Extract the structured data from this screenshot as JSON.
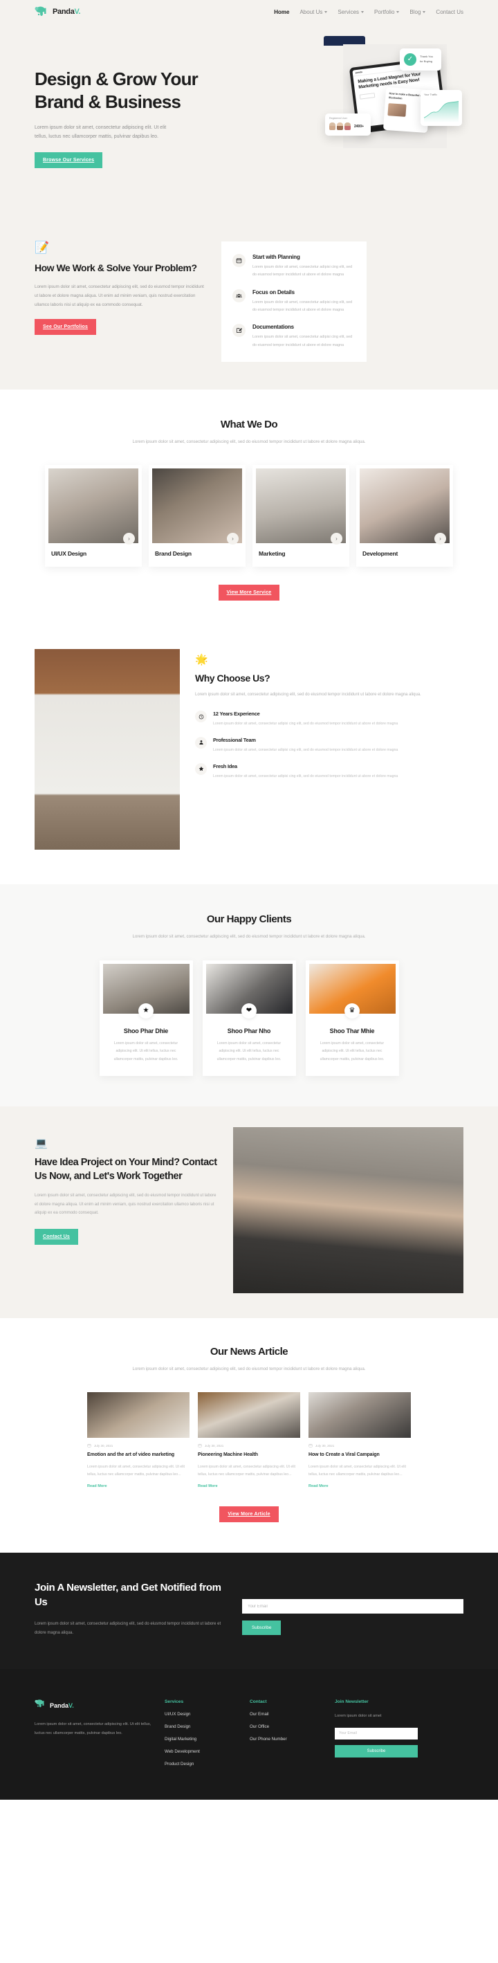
{
  "brand": {
    "name_main": "Panda",
    "name_accent": "V."
  },
  "nav": {
    "items": [
      {
        "label": "Home",
        "has_dropdown": false,
        "active": true
      },
      {
        "label": "About Us",
        "has_dropdown": true,
        "active": false
      },
      {
        "label": "Services",
        "has_dropdown": true,
        "active": false
      },
      {
        "label": "Portfolio",
        "has_dropdown": true,
        "active": false
      },
      {
        "label": "Blog",
        "has_dropdown": true,
        "active": false
      },
      {
        "label": "Contact Us",
        "has_dropdown": false,
        "active": false
      }
    ]
  },
  "hero": {
    "title": "Design & Grow Your Brand & Business",
    "subtitle": "Lorem ipsum dolor sit amet, consectetur adipiscing elit. Ut elit tellus, luctus nec ullamcorper mattis, pulvinar dapibus leo.",
    "cta_label": "Browse Our Services",
    "art": {
      "thanks_line1": "Thank You",
      "thanks_line2": "for Buying",
      "check_icon": "check-icon",
      "laptop_logo": "panda",
      "laptop_headline": "Making a Lead Magnet for Your Marketing needs is Easy Now!",
      "registered_label": "Registered User",
      "registered_count": "2400+",
      "traffic_label": "Your Traffic",
      "article_headline": "How to make a Beautiful and Illustration"
    }
  },
  "howwork": {
    "emoji": "memo-icon",
    "title": "How We Work & Solve Your Problem?",
    "body": "Lorem ipsum dolor sit amet, consectetur adipiscing elit, sed do eiusmod tempor incididunt ut labore et dolore magna aliqua. Ut enim ad minim veniam, quis nostrud exercitation ullamco laboris nisi ut aliquip ex ea commodo consequat.",
    "cta_label": "See Our Portfolios",
    "features": [
      {
        "icon": "calendar-icon",
        "title": "Start with Planning",
        "body": "Lorem ipsum dolor sit amet, consectetur adipisi cing elit, sed do eiusmod tempor incididunt ut abore et dolore magna"
      },
      {
        "icon": "people-icon",
        "title": "Focus on Details",
        "body": "Lorem ipsum dolor sit amet, consectetur adipisi cing elit, sed do eiusmod tempor incididunt ut abore et dolore magna"
      },
      {
        "icon": "edit-note-icon",
        "title": "Documentations",
        "body": "Lorem ipsum dolor sit amet, consectetur adipisi cing elit, sed do eiusmod tempor incididunt ut abore et dolore magna"
      }
    ]
  },
  "whatwedo": {
    "title": "What We Do",
    "subtitle": "Lorem ipsum dolor sit amet, consectetur adipiscing elit, sed do eiusmod tempor incididunt ut labore et dolore magna aliqua.",
    "cta_label": "View More Service",
    "services": [
      {
        "name": "UI/UX Design",
        "arrow": "chevron-right-icon"
      },
      {
        "name": "Brand Design",
        "arrow": "chevron-right-icon"
      },
      {
        "name": "Marketing",
        "arrow": "chevron-right-icon"
      },
      {
        "name": "Development",
        "arrow": "chevron-right-icon"
      }
    ]
  },
  "why": {
    "emoji": "star-emoji-icon",
    "title": "Why Choose Us?",
    "subtitle": "Lorem ipsum dolor sit amet, consectetur adipiscing elit, sed do eiusmod tempor incididunt ut labore et dolore magna aliqua.",
    "items": [
      {
        "icon": "clock-icon",
        "title": "12 Years Experience",
        "body": "Lorem ipsum dolor sit amet, consectetur adipisi cing elit, sed do eiusmod tempor incididunt ut abore et dolore magna"
      },
      {
        "icon": "user-icon",
        "title": "Professional Team",
        "body": "Lorem ipsum dolor sit amet, consectetur adipisi cing elit, sed do eiusmod tempor incididunt ut abore et dolore magna"
      },
      {
        "icon": "star-icon",
        "title": "Fresh Idea",
        "body": "Lorem ipsum dolor sit amet, consectetur adipisi cing elit, sed do eiusmod tempor incididunt ut abore et dolore magna"
      }
    ]
  },
  "clients": {
    "title": "Our Happy Clients",
    "subtitle": "Lorem ipsum dolor sit amet, consectetur adipiscing elit, sed do eiusmod tempor incididunt ut labore et dolore magna aliqua.",
    "cards": [
      {
        "badge": "star-icon",
        "name": "Shoo Phar Dhie",
        "body": "Lorem ipsum dolor sit amet, consectetur adipiscing elit. Ut elit tellus, luctus nec ullamcorper mattis, pulvinar dapibus leo."
      },
      {
        "badge": "heart-icon",
        "name": "Shoo Phar Nho",
        "body": "Lorem ipsum dolor sit amet, consectetur adipiscing elit. Ut elit tellus, luctus nec ullamcorper mattis, pulvinar dapibus leo."
      },
      {
        "badge": "crown-icon",
        "name": "Shoo Thar Mhie",
        "body": "Lorem ipsum dolor sit amet, consectetur adipiscing elit. Ut elit tellus, luctus nec ullamcorper mattis, pulvinar dapibus leo."
      }
    ]
  },
  "cta": {
    "emoji": "technologist-icon",
    "title": "Have Idea Project on Your Mind? Contact Us Now, and Let's Work Together",
    "body": "Lorem ipsum dolor sit amet, consectetur adipiscing elit, sed do eiusmod tempor incididunt ut labore et dolore magna aliqua. Ut enim ad minim veniam, quis nostrud exercitation ullamco laboris nisi ut aliquip ex ea commodo consequat.",
    "button_label": "Contact Us"
  },
  "news": {
    "title": "Our News Article",
    "subtitle": "Lorem ipsum dolor sit amet, consectetur adipiscing elit, sed do eiusmod tempor incididunt ut labore et dolore magna aliqua.",
    "cta_label": "View More Article",
    "articles": [
      {
        "date": "July 30, 2021",
        "title": "Emotion and the art of video marketing",
        "excerpt": "Lorem ipsum dolor sit amet, consectetur adipiscing elit. Ut elit tellus, luctus nec ullamcorper mattis, pulvinar dapibus leo...",
        "link_label": "Read More"
      },
      {
        "date": "July 30, 2021",
        "title": "Pioneering Machine Health",
        "excerpt": "Lorem ipsum dolor sit amet, consectetur adipiscing elit. Ut elit tellus, luctus nec ullamcorper mattis, pulvinar dapibus leo...",
        "link_label": "Read More"
      },
      {
        "date": "July 30, 2021",
        "title": "How to Create a Viral Campaign",
        "excerpt": "Lorem ipsum dolor sit amet, consectetur adipiscing elit. Ut elit tellus, luctus nec ullamcorper mattis, pulvinar dapibus leo...",
        "link_label": "Read More"
      }
    ]
  },
  "newsletter": {
    "title": "Join A Newsletter, and Get Notified from Us",
    "body": "Lorem ipsum dolor sit amet, consectetur adipiscing elit, sed do eiusmod tempor incididunt ut labore et dolore magna aliqua.",
    "email_placeholder": "Your Email",
    "email_value": "",
    "button_label": "Subscribe"
  },
  "footer": {
    "description": "Lorem ipsum dolor sit amet, consectetur adipiscing elit. Ut elit tellus, luctus nec ullamcorper mattis, pulvinar dapibus leo.",
    "services": {
      "heading": "Services",
      "links": [
        "UI/UX Design",
        "Brand Design",
        "Digital Marketing",
        "Web Development",
        "Product Design"
      ]
    },
    "contact": {
      "heading": "Contact",
      "links": [
        "Our Email",
        "Our Office",
        "Our Phone Number"
      ]
    },
    "newsletter": {
      "heading": "Join Newsletter",
      "body": "Lorem ipsum dolor sit amet",
      "email_placeholder": "Your Email",
      "email_value": "",
      "button_label": "Subscribe"
    }
  },
  "colors": {
    "accent_teal": "#45c2a0",
    "accent_red": "#f1555f",
    "cream": "#f4f2ee",
    "dark": "#1c1c1c",
    "footer_dark": "#191919"
  }
}
